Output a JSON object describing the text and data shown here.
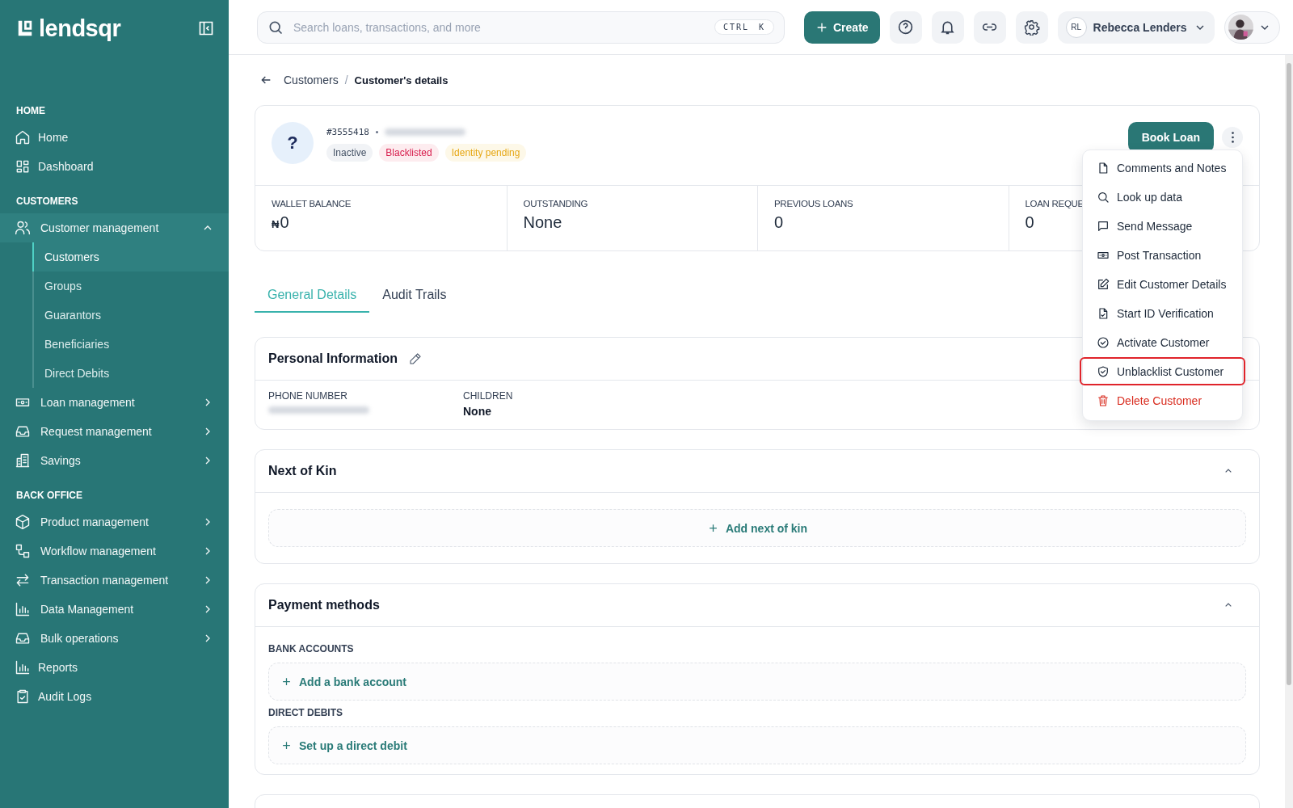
{
  "brand": "lendsqr",
  "search": {
    "placeholder": "Search loans, transactions, and more",
    "shortcut": "CTRL K"
  },
  "topbar": {
    "create_label": "Create",
    "user": {
      "initials": "RL",
      "name": "Rebecca Lenders"
    }
  },
  "sidebar": {
    "sections": [
      {
        "label": "HOME",
        "items": [
          {
            "label": "Home",
            "kind": "link"
          },
          {
            "label": "Dashboard",
            "kind": "link"
          }
        ]
      },
      {
        "label": "CUSTOMERS",
        "items": [
          {
            "label": "Customer management",
            "kind": "group",
            "expanded": true,
            "children": [
              {
                "label": "Customers",
                "selected": true
              },
              {
                "label": "Groups",
                "selected": false
              },
              {
                "label": "Guarantors",
                "selected": false
              },
              {
                "label": "Beneficiaries",
                "selected": false
              },
              {
                "label": "Direct Debits",
                "selected": false
              }
            ]
          },
          {
            "label": "Loan management",
            "kind": "group",
            "expanded": false
          },
          {
            "label": "Request management",
            "kind": "group",
            "expanded": false
          },
          {
            "label": "Savings",
            "kind": "group",
            "expanded": false
          }
        ]
      },
      {
        "label": "BACK OFFICE",
        "items": [
          {
            "label": "Product management",
            "kind": "group",
            "expanded": false
          },
          {
            "label": "Workflow management",
            "kind": "group",
            "expanded": false
          },
          {
            "label": "Transaction management",
            "kind": "group",
            "expanded": false
          },
          {
            "label": "Data Management",
            "kind": "group",
            "expanded": false
          },
          {
            "label": "Bulk operations",
            "kind": "group",
            "expanded": false
          },
          {
            "label": "Reports",
            "kind": "link"
          },
          {
            "label": "Audit Logs",
            "kind": "link"
          }
        ]
      }
    ]
  },
  "breadcrumb": {
    "separator": "/",
    "items": [
      "Customers",
      "Customer's details"
    ]
  },
  "customer": {
    "avatar": "?",
    "id": "#3555418",
    "detail_redacted": true,
    "badges": [
      {
        "label": "Inactive",
        "color": "#f1f3f6"
      },
      {
        "label": "Blacklisted",
        "color": "#fdecef"
      },
      {
        "label": "Identity pending",
        "color": "#fdf8e8"
      }
    ],
    "primary_action": "Book Loan",
    "stats": [
      {
        "label": "WALLET BALANCE",
        "currency": "₦",
        "value": "0"
      },
      {
        "label": "OUTSTANDING",
        "value": "None"
      },
      {
        "label": "PREVIOUS LOANS",
        "value": "0"
      },
      {
        "label": "LOAN REQUE",
        "value": "0"
      }
    ]
  },
  "actions_menu": [
    {
      "label": "Comments and Notes",
      "kind": "normal",
      "highlighted": false
    },
    {
      "label": "Look up data",
      "kind": "normal",
      "highlighted": false
    },
    {
      "label": "Send Message",
      "kind": "normal",
      "highlighted": false
    },
    {
      "label": "Post Transaction",
      "kind": "normal",
      "highlighted": false
    },
    {
      "label": "Edit Customer Details",
      "kind": "normal",
      "highlighted": false
    },
    {
      "label": "Start ID Verification",
      "kind": "normal",
      "highlighted": false
    },
    {
      "label": "Activate Customer",
      "kind": "normal",
      "highlighted": false
    },
    {
      "label": "Unblacklist Customer",
      "kind": "normal",
      "highlighted": true
    },
    {
      "label": "Delete Customer",
      "kind": "danger",
      "highlighted": false
    }
  ],
  "tabs": [
    {
      "label": "General Details",
      "selected": true
    },
    {
      "label": "Audit Trails",
      "selected": false
    }
  ],
  "sections": [
    {
      "kind": "fields",
      "title": "Personal Information",
      "editable": true,
      "fields": [
        {
          "label": "PHONE NUMBER",
          "redacted": true
        },
        {
          "label": "CHILDREN",
          "value": "None"
        }
      ]
    },
    {
      "kind": "single",
      "title": "Next of Kin",
      "expanded": true,
      "action": "Add next of kin"
    },
    {
      "kind": "groups",
      "title": "Payment methods",
      "expanded": true,
      "groups": [
        {
          "label": "BANK ACCOUNTS",
          "action": "Add a bank account"
        },
        {
          "label": "DIRECT DEBITS",
          "action": "Set up a direct debit"
        }
      ]
    }
  ]
}
